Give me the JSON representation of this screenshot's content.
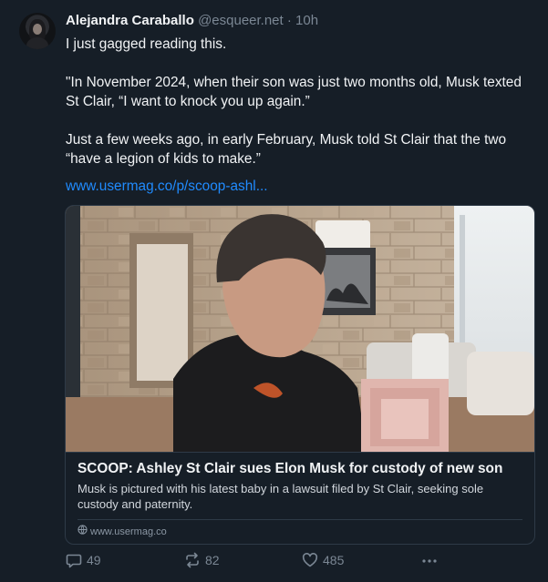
{
  "post": {
    "author_name": "Alejandra Caraballo",
    "author_handle": "@esqueer.net",
    "separator": "·",
    "time": "10h",
    "paragraphs": [
      "I just gagged reading this.",
      "\"In November 2024, when their son was just two months old, Musk texted St Clair, “I want to knock you up again.”",
      "Just a few weeks ago, in early February, Musk told St Clair that the two “have a legion of kids to make.”"
    ],
    "link_text": "www.usermag.co/p/scoop-ashl..."
  },
  "card": {
    "title": "SCOOP: Ashley St Clair sues Elon Musk for custody of new son",
    "description": "Musk is pictured with his latest baby in a lawsuit filed by St Clair, seeking sole custody and paternity.",
    "domain": "www.usermag.co"
  },
  "actions": {
    "replies": "49",
    "reposts": "82",
    "likes": "485"
  },
  "icons": {
    "reply": "speech-bubble-icon",
    "repost": "repost-arrows-icon",
    "like": "heart-icon",
    "more": "ellipsis-icon",
    "domain": "globe-icon"
  },
  "colors": {
    "background": "#161e27",
    "link": "#208bfe",
    "muted": "#7b8794",
    "border": "#2e3a47"
  }
}
